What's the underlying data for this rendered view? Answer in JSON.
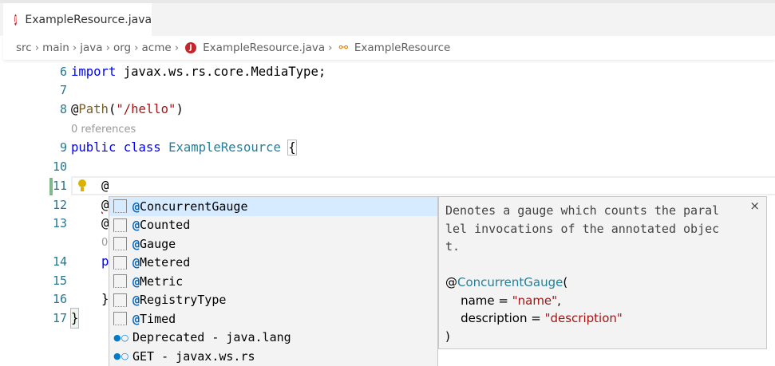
{
  "tab": {
    "title": "ExampleResource.java",
    "icon": "java-file-icon",
    "modified": true
  },
  "breadcrumb": [
    "src",
    "main",
    "java",
    "org",
    "acme",
    "ExampleResource.java",
    "ExampleResource"
  ],
  "editor": {
    "line_numbers": [
      "6",
      "7",
      "8",
      "9",
      "10",
      "11",
      "12",
      "13",
      "14",
      "15",
      "16",
      "17"
    ],
    "references_label": "0 references",
    "references_partial": "0",
    "line6": {
      "kw": "import",
      "rest": " javax.ws.rs.core.MediaType;"
    },
    "line8": {
      "at": "@",
      "ann": "Path",
      "open": "(",
      "str": "\"/hello\"",
      "close": ")"
    },
    "line9": {
      "kw1": "public",
      "kw2": "class",
      "type": "ExampleResource",
      "brace": "{"
    },
    "line11": "@",
    "line12": "@",
    "line13": "@",
    "line14": "p",
    "line16": "}",
    "line17": "}"
  },
  "suggest": {
    "items": [
      {
        "at": "@",
        "label": "ConcurrentGauge",
        "kind": "annotation",
        "selected": true
      },
      {
        "at": "@",
        "label": "Counted",
        "kind": "annotation"
      },
      {
        "at": "@",
        "label": "Gauge",
        "kind": "annotation"
      },
      {
        "at": "@",
        "label": "Metered",
        "kind": "annotation"
      },
      {
        "at": "@",
        "label": "Metric",
        "kind": "annotation"
      },
      {
        "at": "@",
        "label": "RegistryType",
        "kind": "annotation"
      },
      {
        "at": "@",
        "label": "Timed",
        "kind": "annotation"
      },
      {
        "label": "Deprecated - java.lang",
        "kind": "interface"
      },
      {
        "label": "GET - javax.ws.rs",
        "kind": "interface"
      }
    ]
  },
  "doc": {
    "lines": [
      "Denotes a gauge which counts the paral",
      "lel invocations of the annotated objec",
      "t."
    ],
    "sig_at": "@",
    "sig_name": "ConcurrentGauge",
    "sig_open": "(",
    "p1_name": "    name = ",
    "p1_val": "\"name\"",
    "p1_end": ",",
    "p2_name": "    description = ",
    "p2_val": "\"description\"",
    "sig_close": ")",
    "close": "×"
  }
}
